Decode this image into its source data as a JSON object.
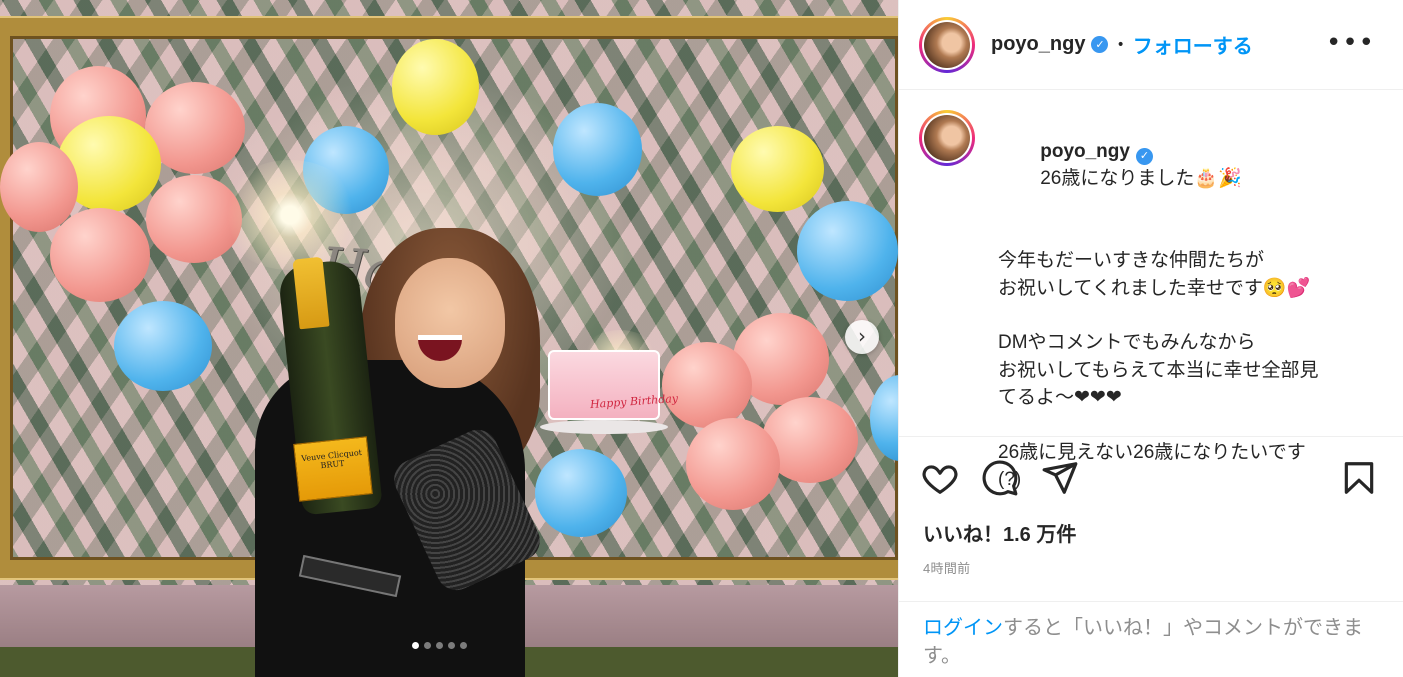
{
  "post": {
    "username": "poyo_ngy",
    "verified": true,
    "separator": "•",
    "follow_label": "フォローする",
    "more_label": "•••",
    "caption_lines": [
      "26歳になりました🎂🎉",
      "",
      "今年もだーいすきな仲間たちが",
      "お祝いしてくれました幸せです🥺💕",
      "",
      "DMやコメントでもみんなから",
      "お祝いしてもらえて本当に幸せ全部見",
      "てるよ〜❤❤❤",
      "",
      "26歳に見えない26歳になりたいです",
      "(?)"
    ],
    "likes_text": "いいね！1.6 万件",
    "time_text": "4時間前",
    "login_link": "ログイン",
    "login_rest": "すると「いいね！」やコメントができます。"
  },
  "media": {
    "banner_text": "Happy Birthday",
    "bottle_label": "Veuve Clicquot BRUT",
    "cake_text": "Happy Birthday",
    "next_arrow": "›",
    "carousel_count": 5,
    "carousel_active": 0
  },
  "icons": {
    "like": "heart-icon",
    "comment": "comment-icon",
    "share": "share-icon",
    "save": "bookmark-icon",
    "more": "more-icon",
    "next": "chevron-right-icon"
  },
  "colors": {
    "accent": "#0095f6",
    "verified": "#3897f0",
    "muted": "#8e8e8e",
    "text": "#262626"
  }
}
